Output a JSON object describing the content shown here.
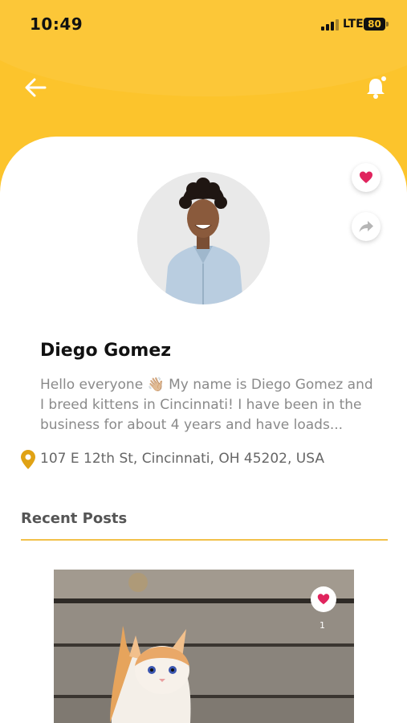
{
  "status_bar": {
    "time": "10:49",
    "network": "LTE",
    "battery": "80"
  },
  "icons": {
    "back": "arrow-left-icon",
    "notifications": "bell-icon",
    "favorite": "heart-icon",
    "share": "share-icon",
    "location": "map-pin-icon"
  },
  "colors": {
    "accent": "#fcc42c",
    "heart": "#e0245e",
    "pin": "#e0a214",
    "divider": "#f2c14a"
  },
  "profile": {
    "name": "Diego Gomez",
    "bio": "Hello everyone 👋🏼 My name is Diego Gomez and I breed kittens in Cincinnati! I have been in the business for about 4 years and have loads...",
    "address": "107 E 12th St, Cincinnati, OH 45202, USA"
  },
  "recent_posts": {
    "title": "Recent Posts",
    "posts": [
      {
        "likes": "1"
      }
    ]
  }
}
